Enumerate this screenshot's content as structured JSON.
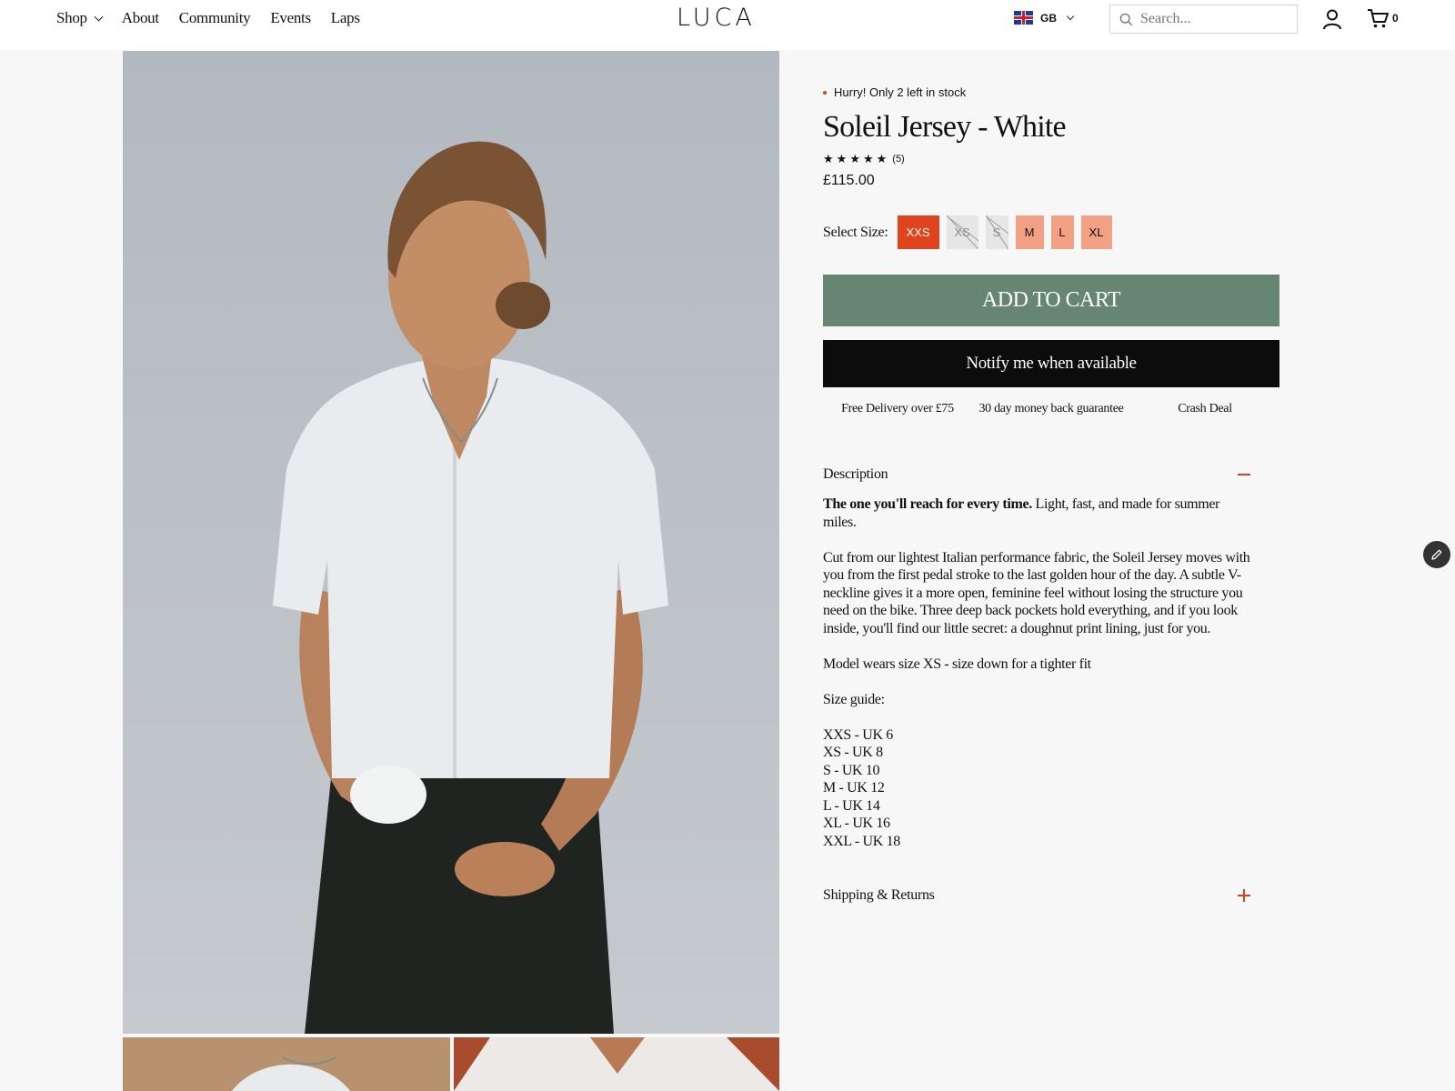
{
  "nav": {
    "shop": "Shop",
    "about": "About",
    "community": "Community",
    "events": "Events",
    "laps": "Laps"
  },
  "logo": "LUCA",
  "locale": {
    "country": "GB"
  },
  "search": {
    "placeholder": "Search..."
  },
  "cart": {
    "count": "0"
  },
  "product": {
    "stock_notice": "Hurry! Only 2 left in stock",
    "title": "Soleil Jersey - White",
    "rating_stars": 5,
    "review_count": "(5)",
    "price": "£115.00",
    "size_label": "Select Size:",
    "sizes": [
      {
        "label": "XXS",
        "state": "selected"
      },
      {
        "label": "XS",
        "state": "sold-out"
      },
      {
        "label": "S",
        "state": "sold-out"
      },
      {
        "label": "M",
        "state": "available"
      },
      {
        "label": "L",
        "state": "available"
      },
      {
        "label": "XL",
        "state": "available"
      }
    ],
    "add_to_cart": "ADD TO CART",
    "notify": "Notify me when available",
    "perks": [
      "Free Delivery over £75",
      "30 day money back guarantee",
      "Crash Deal"
    ]
  },
  "description": {
    "heading": "Description",
    "lead_bold": "The one you'll reach for every time.",
    "lead_rest": " Light, fast, and made for summer miles.",
    "body": "Cut from our lightest Italian performance fabric, the Soleil Jersey moves with you from the first pedal stroke to the last golden hour of the day. A subtle V-neckline gives it a more open, feminine feel without losing the structure you need on the bike. Three deep back pockets hold everything, and if you look inside, you'll find our little secret: a doughnut print lining, just for you.",
    "model_note": "Model wears size XS - size down for a tighter fit",
    "size_guide_title": "Size guide:",
    "size_guide": [
      "XXS - UK 6",
      "XS - UK 8",
      "S - UK 10",
      "M - UK 12",
      "L - UK 14",
      "XL - UK 16",
      "XXL - UK 18"
    ]
  },
  "shipping": {
    "heading": "Shipping & Returns"
  },
  "colors": {
    "accent": "#e0441c",
    "add_to_cart_bg": "#668572",
    "notify_bg": "#0c0c0c",
    "available_size_bg": "#f2a184"
  }
}
